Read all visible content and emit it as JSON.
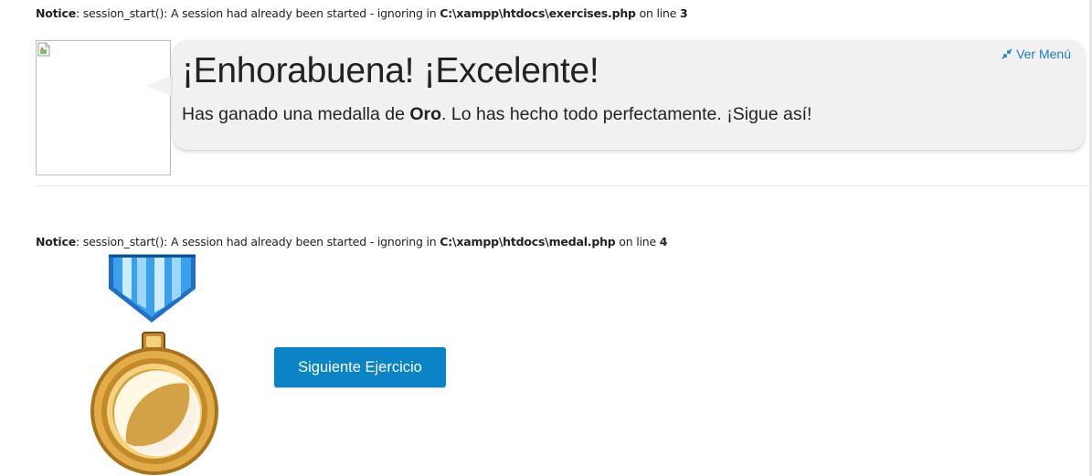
{
  "notices": [
    {
      "label": "Notice",
      "message": ": session_start(): A session had already been started - ignoring in ",
      "file": "C:\\xampp\\htdocs\\exercises.php",
      "line_text": " on line ",
      "line": "3"
    },
    {
      "label": "Notice",
      "message": ": session_start(): A session had already been started - ignoring in ",
      "file": "C:\\xampp\\htdocs\\medal.php",
      "line_text": " on line ",
      "line": "4"
    }
  ],
  "bubble": {
    "title": "¡Enhorabuena! ¡Excelente!",
    "text_before": "Has ganado una medalla de ",
    "medal_name": "Oro",
    "text_after": ". Lo has hecho todo perfectamente. ¡Sigue así!",
    "menu_link": "Ver Menú",
    "menu_icon": "compress-arrows-icon"
  },
  "medal": {
    "type": "gold-medal",
    "colors": {
      "ribbon_blue": "#2a8fe0",
      "ribbon_light": "#bfe6ff",
      "gold": "#d9a441",
      "gold_dark": "#a9721d",
      "gold_light": "#f7d98a"
    }
  },
  "next_button": {
    "label": "Siguiente Ejercicio",
    "color": "#0a84c6"
  }
}
